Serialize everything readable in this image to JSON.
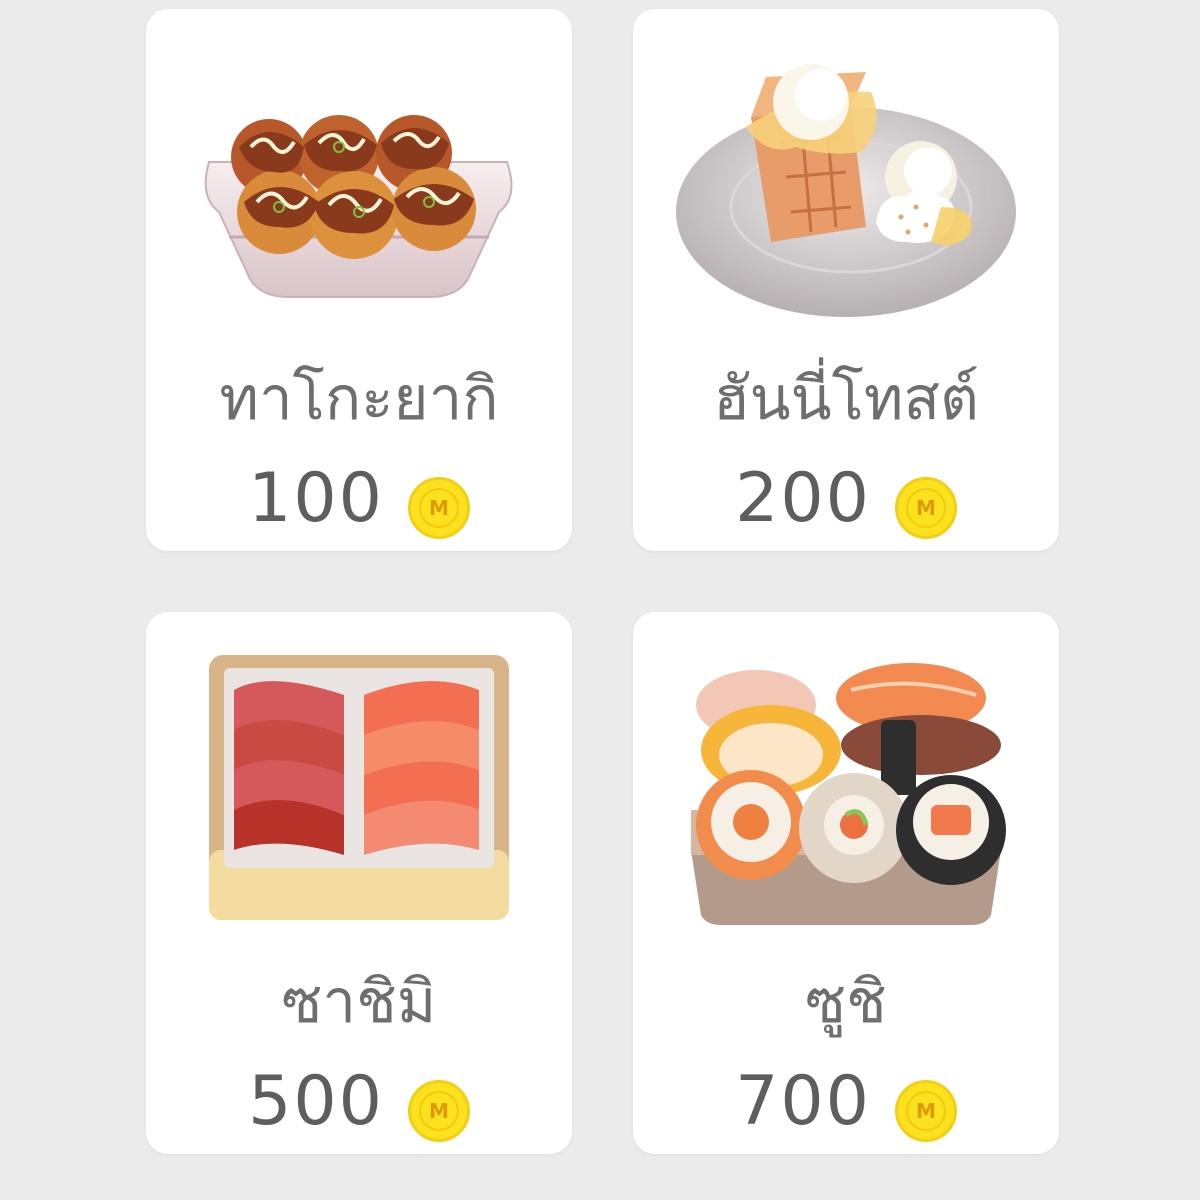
{
  "currency": {
    "symbol": "M",
    "color": "#fbe11e"
  },
  "items": [
    {
      "name": "ทาโกะยากิ",
      "price": "100",
      "icon": "takoyaki-icon"
    },
    {
      "name": "ฮันนี่โทสต์",
      "price": "200",
      "icon": "honey-toast-icon"
    },
    {
      "name": "ซาชิมิ",
      "price": "500",
      "icon": "sashimi-icon"
    },
    {
      "name": "ซูชิ",
      "price": "700",
      "icon": "sushi-icon"
    }
  ]
}
